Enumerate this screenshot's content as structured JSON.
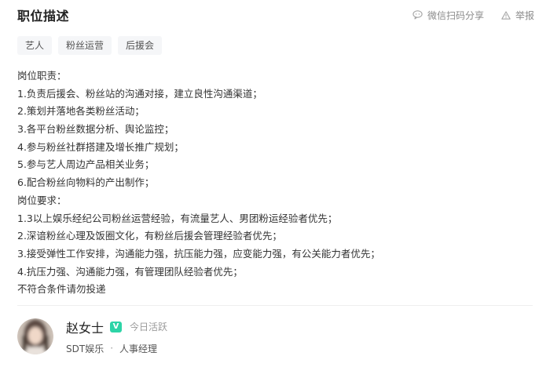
{
  "header": {
    "title": "职位描述",
    "share_label": "微信扫码分享",
    "report_label": "举报"
  },
  "tags": [
    "艺人",
    "粉丝运营",
    "后援会"
  ],
  "description": [
    "岗位职责：",
    "1.负责后援会、粉丝站的沟通对接，建立良性沟通渠道；",
    "2.策划并落地各类粉丝活动；",
    "3.各平台粉丝数据分析、舆论监控；",
    "4.参与粉丝社群搭建及增长推广规划；",
    "5.参与艺人周边产品相关业务；",
    "6.配合粉丝向物料的产出制作；",
    "岗位要求：",
    "1.3以上娱乐经纪公司粉丝运营经验，有流量艺人、男团粉运经验者优先；",
    "2.深谙粉丝心理及饭圈文化，有粉丝后援会管理经验者优先；",
    "3.接受弹性工作安排，沟通能力强，抗压能力强，应变能力强，有公关能力者优先；",
    "4.抗压力强、沟通能力强，有管理团队经验者优先；",
    "不符合条件请勿投递"
  ],
  "recruiter": {
    "name": "赵女士",
    "verified_mark": "V",
    "activity": "今日活跃",
    "company": "SDT娱乐",
    "separator": "·",
    "role": "人事经理"
  },
  "colors": {
    "verified_badge": "#2dd4a7",
    "muted_text": "#8a8a8a",
    "tag_bg": "#f5f6f8"
  },
  "icons": {
    "share": "wechat-bubble-icon",
    "report": "warning-triangle-icon",
    "avatar": "blurred-profile-photo"
  }
}
